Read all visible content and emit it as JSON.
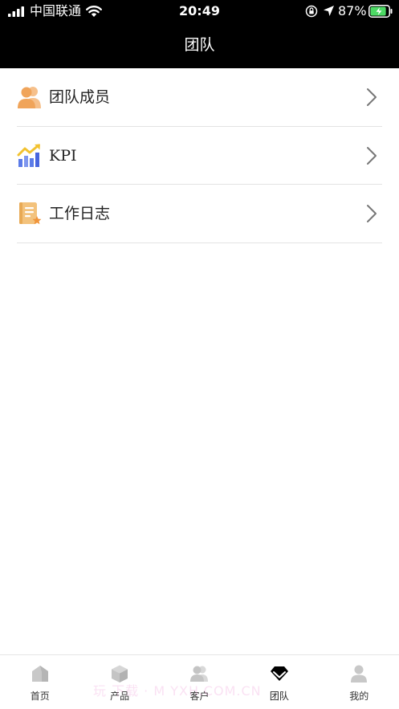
{
  "status": {
    "carrier": "中国联通",
    "time": "20:49",
    "battery_percent": "87%",
    "battery_level": 0.87
  },
  "header": {
    "title": "团队"
  },
  "menu": {
    "items": [
      {
        "label": "团队成员",
        "icon": "team-members-icon"
      },
      {
        "label": "KPI",
        "icon": "kpi-chart-icon"
      },
      {
        "label": "工作日志",
        "icon": "work-log-icon"
      }
    ]
  },
  "tabbar": {
    "tabs": [
      {
        "label": "首页",
        "icon": "home-icon",
        "active": false
      },
      {
        "label": "产品",
        "icon": "product-box-icon",
        "active": false
      },
      {
        "label": "客户",
        "icon": "customer-icon",
        "active": false
      },
      {
        "label": "团队",
        "icon": "team-diamond-icon",
        "active": true
      },
      {
        "label": "我的",
        "icon": "profile-icon",
        "active": false
      }
    ]
  },
  "watermark": "玩   下载 · M   YXH.COM.CN",
  "colors": {
    "header_bg": "#000000",
    "accent_orange": "#F0A45A",
    "kpi_blue": "#5B7BE8",
    "kpi_yellow": "#F2C230",
    "battery_green": "#4CD964",
    "tab_icon_inactive": "#C8C8C8",
    "tab_icon_active": "#000000"
  }
}
